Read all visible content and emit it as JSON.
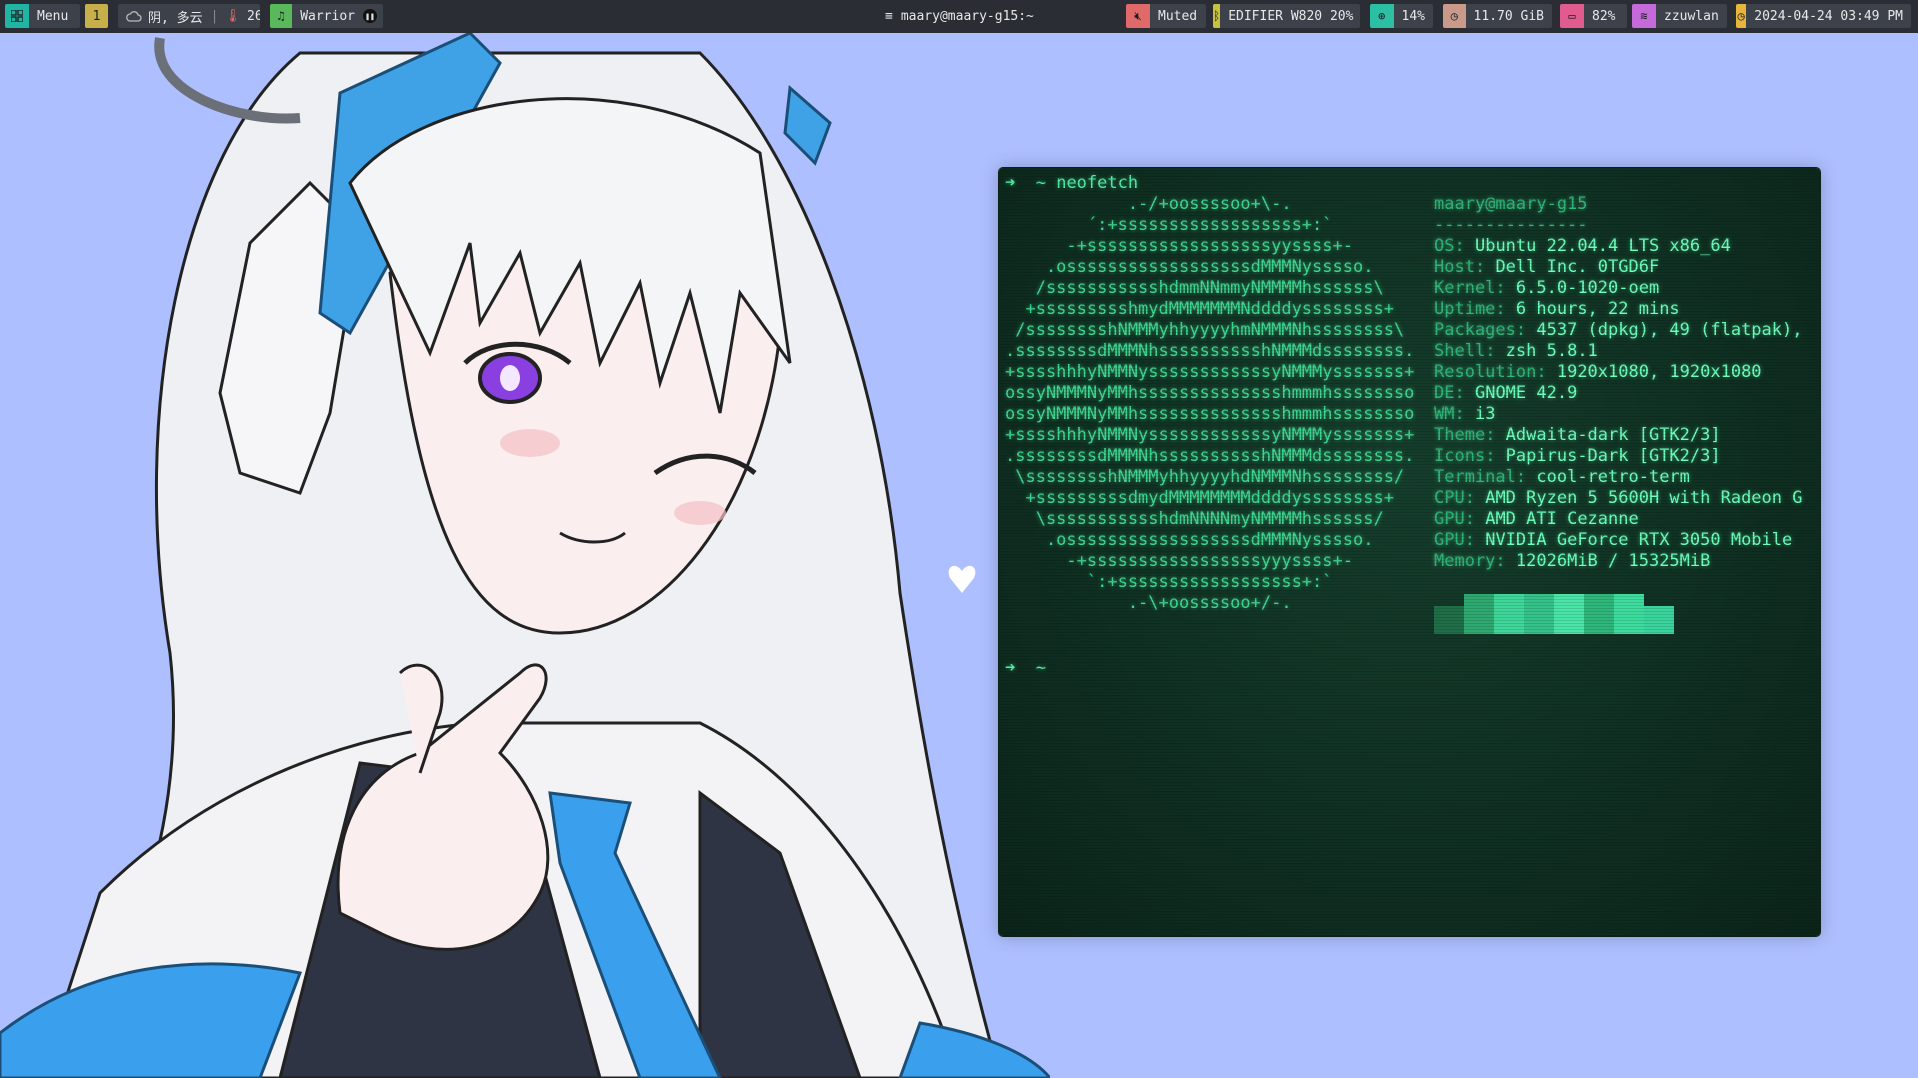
{
  "topbar": {
    "menu_label": "Menu",
    "workspace": "1",
    "weather": "阴, 多云",
    "temperature": "26",
    "music": "Warrior",
    "window_title": "maary@maary-g15:~",
    "volume": "Muted",
    "bluetooth": "EDIFIER W820 20%",
    "cpu": "14%",
    "memory": "11.70 GiB",
    "battery": "82%",
    "wifi": "zzuwlan",
    "datetime": "2024-04-24 03:49 PM"
  },
  "colors": {
    "menu": "#23b5a3",
    "workspace": "#c7b04a",
    "music": "#59b85a",
    "volume": "#e06a6a",
    "bluetooth": "#c6c23e",
    "cpu": "#2bbfa3",
    "memory": "#c99a8a",
    "battery": "#e15b8e",
    "wifi": "#c56ad9",
    "clock": "#e7b43c",
    "wallpaper": "#aebfff",
    "terminal_text": "#4ff0a8"
  },
  "icons": {
    "menu": "grid-icon",
    "weather": "cloud-icon",
    "temperature": "thermometer-icon",
    "music": "music-note-icon",
    "pause": "pause-icon",
    "window": "hamburger-icon",
    "volume": "speaker-muted-icon",
    "bluetooth": "bluetooth-icon",
    "cpu": "cpu-icon",
    "memory": "clock-icon",
    "battery": "battery-icon",
    "wifi": "wifi-icon",
    "clock": "clock-icon"
  },
  "terminal": {
    "prompt_arrow": "➜",
    "command_line": "~ neofetch",
    "last_prompt": "~",
    "user_host": "maary@maary-g15",
    "separator": "---------------",
    "ascii_art": "            .-/+oossssoo+\\-.\n        ´:+ssssssssssssssssss+:`\n      -+ssssssssssssssssssyyssss+-\n    .ossssssssssssssssssdMMMNysssso.\n   /ssssssssssshdmmNNmmyNMMMMhssssss\\\n  +ssssssssshmydMMMMMMMNddddyssssssss+\n /sssssssshNMMMyhhyyyyhmNMMMNhssssssss\\\n.ssssssssdMMMNhsssssssssshNMMMdssssssss.\n+sssshhhyNMMNyssssssssssssyNMMMysssssss+\nossyNMMMNyMMhsssssssssssssshmmmhssssssso\nossyNMMMNyMMhsssssssssssssshmmmhssssssso\n+sssshhhyNMMNyssssssssssssyNMMMysssssss+\n.ssssssssdMMMNhsssssssssshNMMMdssssssss.\n \\sssssssshNMMMyhhyyyyhdNMMMNhssssssss/\n  +sssssssssdmydMMMMMMMMddddyssssssss+\n   \\ssssssssssshdmNNNNmyNMMMMhssssss/\n    .ossssssssssssssssssdMMMNysssso.\n      -+sssssssssssssssssyyyssss+-\n        `:+ssssssssssssssssss+:`\n            .-\\+oossssoo+/-.",
    "info": [
      {
        "key": "OS",
        "value": "Ubuntu 22.04.4 LTS x86_64"
      },
      {
        "key": "Host",
        "value": "Dell Inc. 0TGD6F"
      },
      {
        "key": "Kernel",
        "value": "6.5.0-1020-oem"
      },
      {
        "key": "Uptime",
        "value": "6 hours, 22 mins"
      },
      {
        "key": "Packages",
        "value": "4537 (dpkg), 49 (flatpak),"
      },
      {
        "key": "Shell",
        "value": "zsh 5.8.1"
      },
      {
        "key": "Resolution",
        "value": "1920x1080, 1920x1080"
      },
      {
        "key": "DE",
        "value": "GNOME 42.9"
      },
      {
        "key": "WM",
        "value": "i3"
      },
      {
        "key": "Theme",
        "value": "Adwaita-dark [GTK2/3]"
      },
      {
        "key": "Icons",
        "value": "Papirus-Dark [GTK2/3]"
      },
      {
        "key": "Terminal",
        "value": "cool-retro-term"
      },
      {
        "key": "CPU",
        "value": "AMD Ryzen 5 5600H with Radeon G"
      },
      {
        "key": "GPU",
        "value": "AMD ATI Cezanne"
      },
      {
        "key": "GPU",
        "value": "NVIDIA GeForce RTX 3050 Mobile"
      },
      {
        "key": "Memory",
        "value": "12026MiB / 15325MiB"
      }
    ],
    "palette": [
      "#1f6e48",
      "#2fa870",
      "#3fd69a",
      "#34c28a",
      "#4ae3a8",
      "#2fb67a",
      "#3ddc9e",
      "#3ad39c"
    ]
  }
}
